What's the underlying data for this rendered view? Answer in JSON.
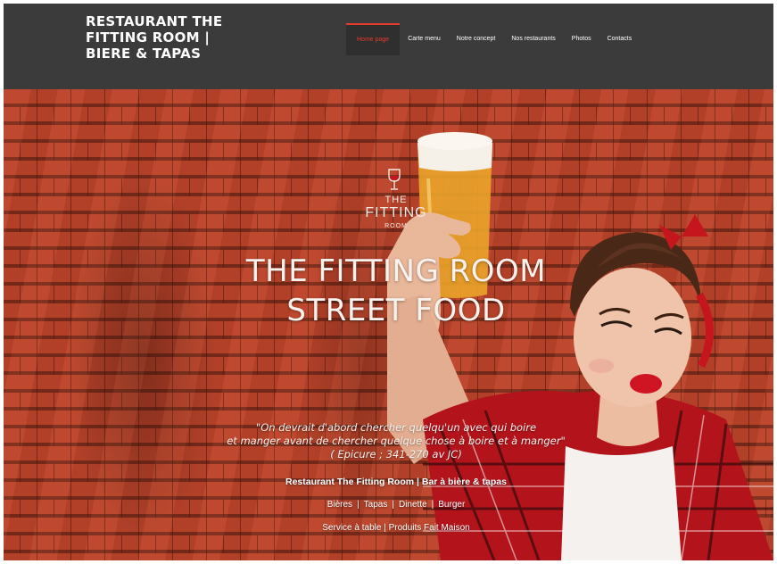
{
  "header": {
    "site_title_line1": "RESTAURANT THE",
    "site_title_line2": "FITTING ROOM |",
    "site_title_line3": "BIERE & TAPAS"
  },
  "nav": {
    "items": [
      {
        "label": "Home page",
        "active": true
      },
      {
        "label": "Carte menu"
      },
      {
        "label": "Notre concept"
      },
      {
        "label": "Nos restaurants"
      },
      {
        "label": "Photos"
      },
      {
        "label": "Contacts"
      }
    ]
  },
  "logo": {
    "line1": "THE",
    "line2": "FITTING",
    "line3": "ROOM"
  },
  "hero": {
    "title_line1": "THE FITTING ROOM",
    "title_line2": "STREET FOOD",
    "quote_line1": "\"On devrait d'abord chercher quelqu'un avec qui boire",
    "quote_line2": "et manger avant de chercher quelque chose à boire et à manger\"",
    "quote_source": "( Epicure ; 341-270 av JC)",
    "tagline": "Restaurant The Fitting Room | Bar à bière & tapas",
    "tags": [
      "Bières",
      "Tapas",
      "Dinette",
      "Burger"
    ],
    "services": "Service à table | Produits Fait Maison"
  },
  "colors": {
    "header_bg": "#3b3b3b",
    "accent": "#e53b2c",
    "brick": "#b8442c"
  }
}
